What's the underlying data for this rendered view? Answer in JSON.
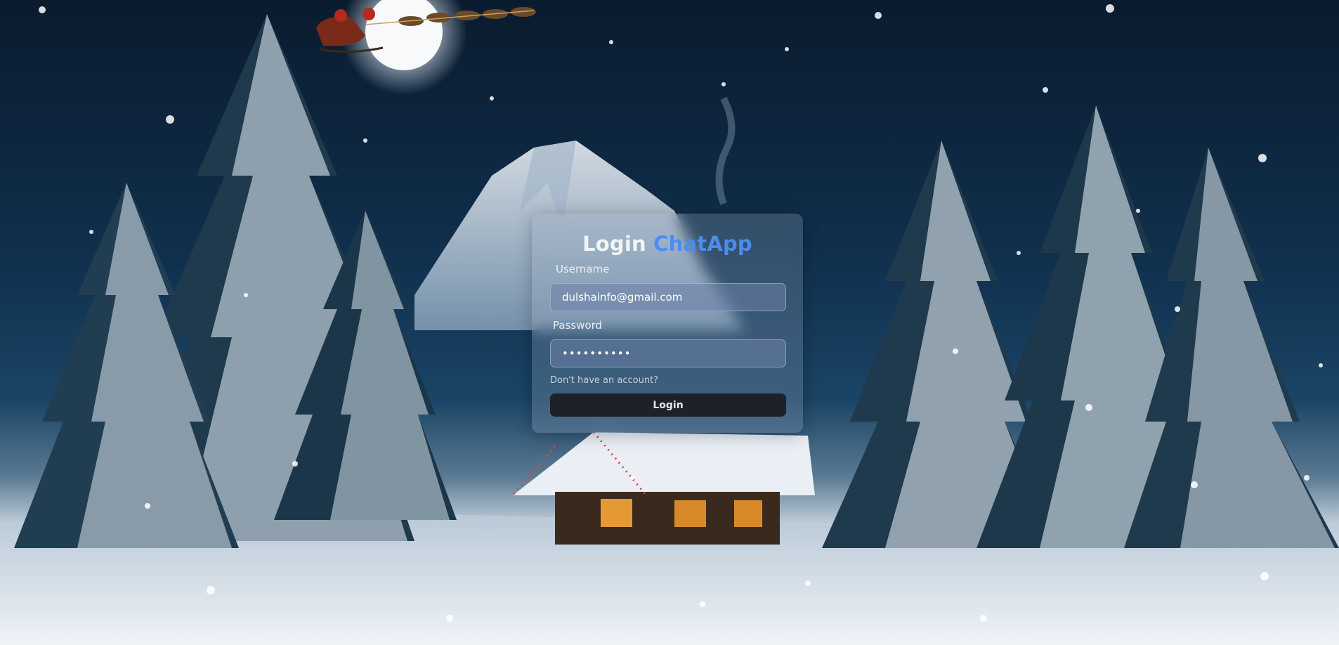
{
  "login": {
    "title": "Login",
    "brand": "ChatApp",
    "username_label": "Username",
    "username_value": "dulshainfo@gmail.com",
    "password_label": "Password",
    "password_value": "••••••••••",
    "signup_link": "Don't have an account?",
    "login_button": "Login"
  },
  "colors": {
    "brand_accent": "#4b8cf0",
    "button_bg": "#1e2128",
    "sky": "#0a1b2e"
  }
}
